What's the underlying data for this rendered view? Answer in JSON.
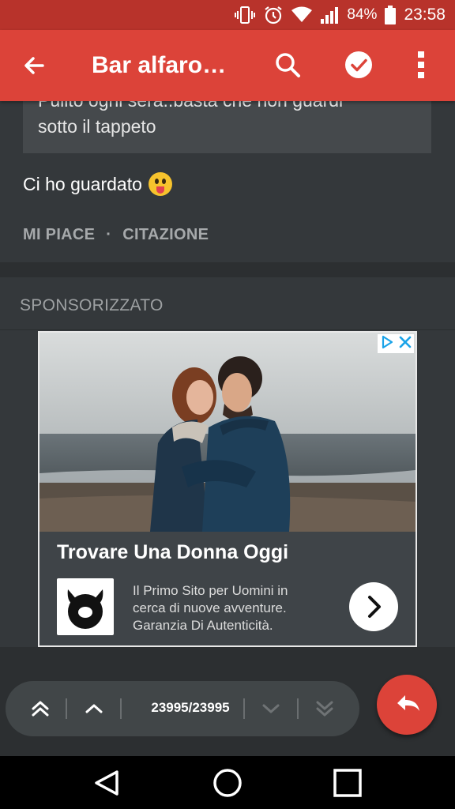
{
  "status_bar": {
    "battery": "84%",
    "time": "23:58"
  },
  "app_bar": {
    "title": "Bar alfarom…"
  },
  "post": {
    "quote_line1": "Pulito ogni sera..basta che non guardi",
    "quote_line2": "sotto il tappeto",
    "text": "Ci ho guardato",
    "emoji": "tongue-out-emoji",
    "actions": {
      "like": "MI PIACE",
      "separator": "·",
      "quote": "CITAZIONE"
    }
  },
  "sponsored": {
    "label": "SPONSORIZZATO",
    "ad": {
      "title": "Trovare Una Donna Oggi",
      "description": [
        "Il Primo Sito per Uomini in",
        "cerca di nuove avventure.",
        "Garanzia Di Autenticità."
      ],
      "badge_icons": [
        "adchoices-icon",
        "close-icon"
      ]
    }
  },
  "pagination": {
    "counter": "23995/23995"
  },
  "colors": {
    "primary": "#dc4339",
    "status_bar": "#b8332b",
    "background": "#2c2f31",
    "card": "#34383b"
  }
}
